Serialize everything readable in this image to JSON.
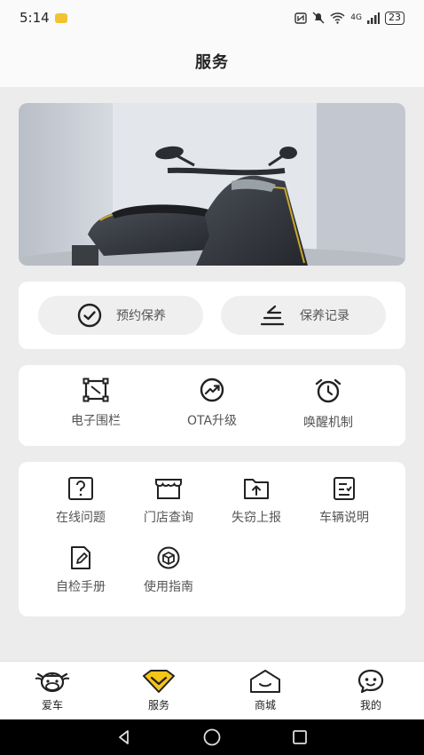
{
  "status_bar": {
    "time": "5:14",
    "network": "4G",
    "battery": "23"
  },
  "header": {
    "title": "服务"
  },
  "banner": {
    "image": "electric-scooter-photo"
  },
  "quick_actions": [
    {
      "label": "预约保养",
      "icon": "check-circle-icon"
    },
    {
      "label": "保养记录",
      "icon": "record-icon"
    }
  ],
  "features": [
    {
      "label": "电子围栏",
      "icon": "fence-icon"
    },
    {
      "label": "OTA升级",
      "icon": "upgrade-icon"
    },
    {
      "label": "唤醒机制",
      "icon": "alarm-clock-icon"
    }
  ],
  "tools": [
    {
      "label": "在线问题",
      "icon": "question-icon"
    },
    {
      "label": "门店查询",
      "icon": "store-icon"
    },
    {
      "label": "失窃上报",
      "icon": "report-upload-icon"
    },
    {
      "label": "车辆说明",
      "icon": "checklist-icon"
    },
    {
      "label": "自检手册",
      "icon": "manual-icon"
    },
    {
      "label": "使用指南",
      "icon": "guide-box-icon"
    }
  ],
  "tabs": [
    {
      "label": "爱车",
      "icon": "cow-icon",
      "active": false
    },
    {
      "label": "服务",
      "icon": "diamond-icon",
      "active": true
    },
    {
      "label": "商城",
      "icon": "shop-icon",
      "active": false
    },
    {
      "label": "我的",
      "icon": "chat-face-icon",
      "active": false
    }
  ],
  "colors": {
    "accent": "#f5c518",
    "background": "#ececec",
    "card": "#ffffff"
  }
}
